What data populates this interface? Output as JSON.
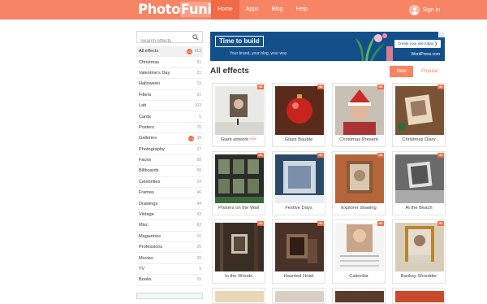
{
  "header": {
    "logo_part1": "Photo",
    "logo_part2": "Funia",
    "nav": [
      {
        "label": "Home",
        "active": true
      },
      {
        "label": "Apps",
        "active": false
      },
      {
        "label": "Blog",
        "active": false
      },
      {
        "label": "Help",
        "active": false
      }
    ],
    "signin_label": "Sign in",
    "colors": {
      "topbar": "#f78464",
      "accent": "#f26a46"
    }
  },
  "sidebar": {
    "search_placeholder": "Search effects",
    "search_icon": "search-icon",
    "categories": [
      {
        "name": "All effects",
        "count": "613",
        "badge": "+3",
        "active": true
      },
      {
        "name": "Christmas",
        "count": "31"
      },
      {
        "name": "Valentine's Day",
        "count": "21"
      },
      {
        "name": "Halloween",
        "count": "19"
      },
      {
        "name": "Filters",
        "count": "31"
      },
      {
        "name": "Lab",
        "count": "103"
      },
      {
        "name": "Cards",
        "count": "5"
      },
      {
        "name": "Posters",
        "count": "76"
      },
      {
        "name": "Galleries",
        "count": "39",
        "badge": "+1"
      },
      {
        "name": "Photography",
        "count": "37"
      },
      {
        "name": "Faces",
        "count": "88"
      },
      {
        "name": "Billboards",
        "count": "58"
      },
      {
        "name": "Celebrities",
        "count": "24"
      },
      {
        "name": "Frames",
        "count": "46"
      },
      {
        "name": "Drawings",
        "count": "44"
      },
      {
        "name": "Vintage",
        "count": "42"
      },
      {
        "name": "Misc",
        "count": "82"
      },
      {
        "name": "Magazines",
        "count": "16"
      },
      {
        "name": "Professions",
        "count": "25"
      },
      {
        "name": "Movies",
        "count": "20"
      },
      {
        "name": "TV",
        "count": "9"
      },
      {
        "name": "Books",
        "count": "15"
      }
    ]
  },
  "banner": {
    "headline": "Time to build",
    "subline": "Your brand, your blog, your way",
    "button": "Create your site today ❯",
    "brand": "WordPress.com"
  },
  "main": {
    "heading": "All effects",
    "sort_new": "New",
    "sort_popular": "Popular",
    "effects": [
      {
        "label": "Giant artwork",
        "new_tag": "NEW!",
        "hd": "HD"
      },
      {
        "label": "Glass Bauble",
        "hd": "HD"
      },
      {
        "label": "Christmas Present",
        "hd": "HD"
      },
      {
        "label": "Christmas Diary",
        "hd": "HD"
      },
      {
        "label": "Posters on the Wall",
        "hd": "HD"
      },
      {
        "label": "Festive Days",
        "hd": "HD"
      },
      {
        "label": "Explorer drawing",
        "hd": "HD"
      },
      {
        "label": "At the Beach",
        "hd": "HD"
      },
      {
        "label": "In the Woods",
        "hd": "HD"
      },
      {
        "label": "Haunted Hotel",
        "hd": "HD"
      },
      {
        "label": "Calendar",
        "hd": "HD"
      },
      {
        "label": "Banksy Shredder",
        "hd": "HD"
      }
    ]
  }
}
